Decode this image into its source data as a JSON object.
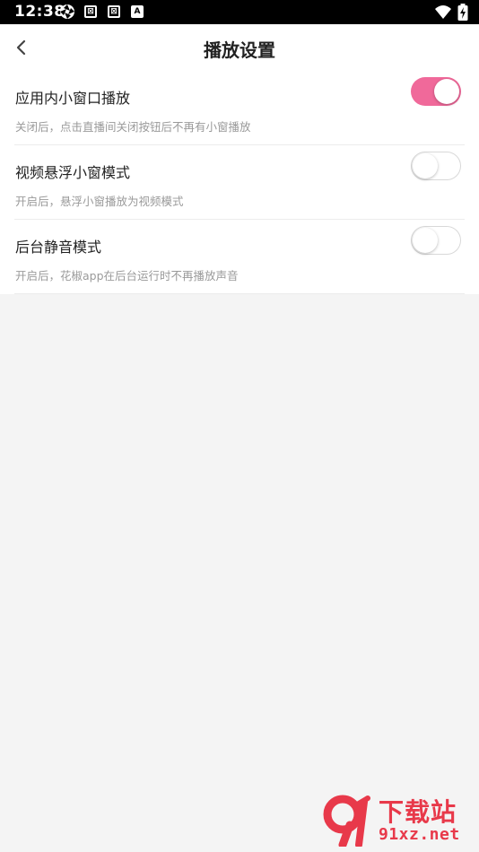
{
  "status_bar": {
    "time": "12:38",
    "icons_left": [
      "aperture-icon",
      "image-icon",
      "image-icon",
      "a-letter-icon"
    ],
    "icons_right": [
      "wifi-icon",
      "battery-charging-icon"
    ],
    "box_glyph_1": "⊠",
    "box_glyph_2": "⊠",
    "box_glyph_3": "A"
  },
  "header": {
    "title": "播放设置",
    "back_icon": "chevron-left-icon"
  },
  "settings": [
    {
      "title": "应用内小窗口播放",
      "description": "关闭后，点击直播间关闭按钮后不再有小窗播放",
      "enabled": true
    },
    {
      "title": "视频悬浮小窗模式",
      "description": "开启后，悬浮小窗播放为视频模式",
      "enabled": false
    },
    {
      "title": "后台静音模式",
      "description": "开启后，花椒app在后台运行时不再播放声音",
      "enabled": false
    }
  ],
  "colors": {
    "accent": "#f0699a",
    "background": "#f4f4f4",
    "watermark": "#e8394a"
  },
  "watermark": {
    "title": "下载站",
    "url": "91xz.net"
  }
}
